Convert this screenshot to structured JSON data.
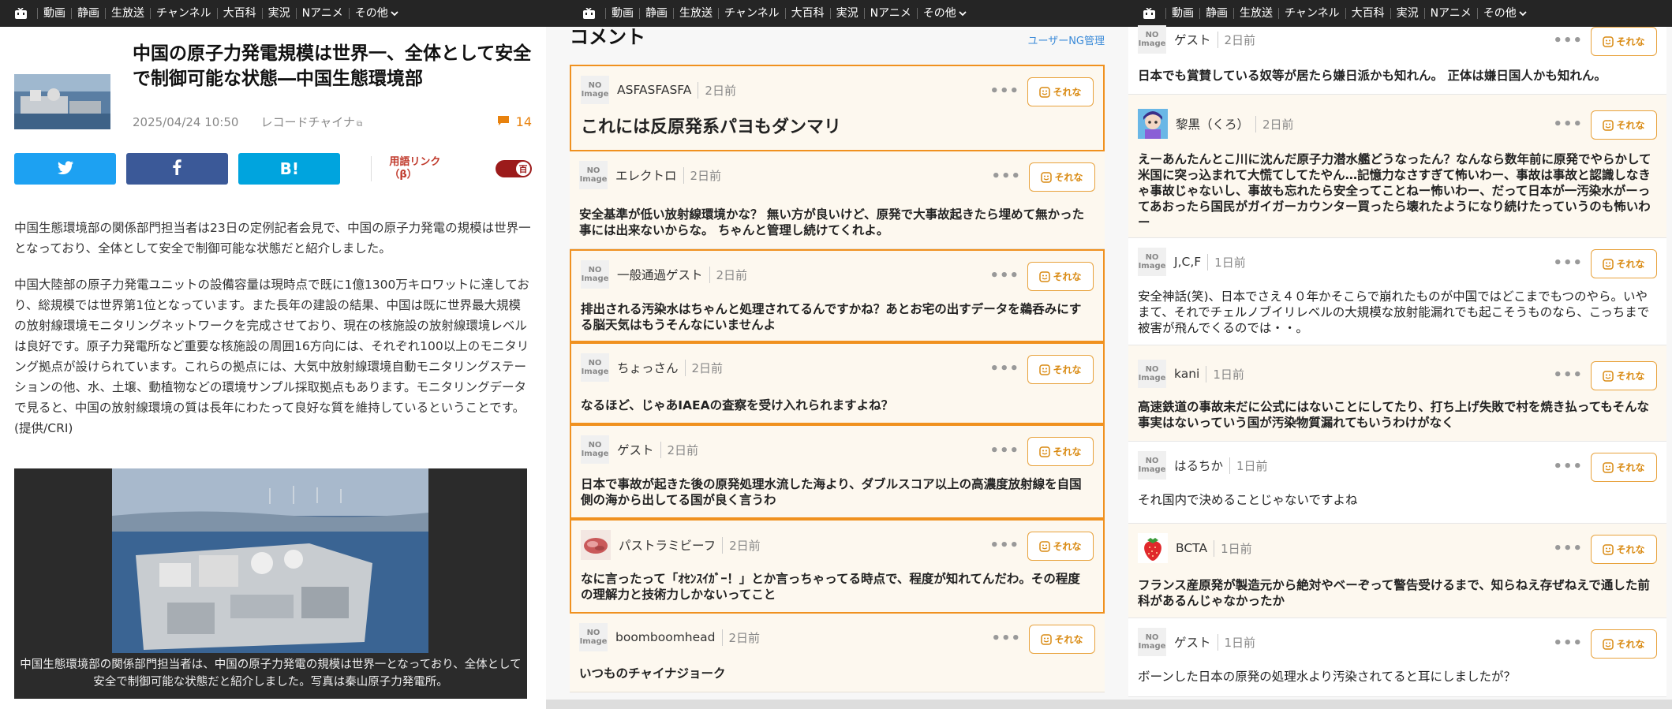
{
  "nav": {
    "items": [
      "動画",
      "静画",
      "生放送",
      "チャンネル",
      "大百科",
      "実況",
      "Nアニメ",
      "その他"
    ]
  },
  "article": {
    "title": "中国の原子力発電規模は世界一、全体として安全で制御可能な状態―中国生態環境部",
    "datetime": "2025/04/24 10:50",
    "source": "レコードチャイナ",
    "comment_count": "14",
    "share": {
      "hatena": "B!"
    },
    "yougo_link": "用語リンク（β）",
    "toggle_glyph": "百",
    "paragraphs": [
      "中国生態環境部の関係部門担当者は23日の定例記者会見で、中国の原子力発電の規模は世界一となっており、全体として安全で制御可能な状態だと紹介しました。",
      "中国大陸部の原子力発電ユニットの設備容量は現時点で既に1億1300万キロワットに達しており、総規模では世界第1位となっています。また長年の建設の結果、中国は既に世界最大規模の放射線環境モニタリングネットワークを完成させており、現在の核施設の放射線環境レベルは良好です。原子力発電所など重要な核施設の周囲16方向には、それぞれ100以上のモニタリング拠点が設けられています。これらの拠点には、大気中放射線環境自動モニタリングステーションの他、水、土壌、動植物などの環境サンプル採取拠点もあります。モニタリングデータで見ると、中国の放射線環境の質は長年にわたって良好な質を維持しているということです。(提供/CRI)"
    ],
    "photo_caption": "中国生態環境部の関係部門担当者は、中国の原子力発電の規模は世界一となっており、全体として安全で制御可能な状態だと紹介しました。写真は秦山原子力発電所。"
  },
  "comments_header": {
    "title": "コメント",
    "ng_link": "ユーザーNG管理"
  },
  "reaction_label": "それな",
  "noimage_label": "NO Image",
  "comments_mid": [
    {
      "name": "ASFASFASFA",
      "time": "2日前",
      "text": "これには反原発系パヨもダンマリ",
      "avatar": "noimage"
    },
    {
      "name": "エレクトロ",
      "time": "2日前",
      "text": "安全基準が低い放射線環境かな？ 無い方が良いけど、原発で大事故起きたら埋めて無かった事には出来ないからな。 ちゃんと管理し続けてくれよ。",
      "avatar": "noimage"
    },
    {
      "name": "一般通過ゲスト",
      "time": "2日前",
      "text": "排出される汚染水はちゃんと処理されてるんですかね？あとお宅の出すデータを鵜呑みにする脳天気はもうそんなにいませんよ",
      "avatar": "noimage"
    },
    {
      "name": "ちょっさん",
      "time": "2日前",
      "text": "なるほど、じゃあIAEAの査察を受け入れられますよね？",
      "avatar": "noimage"
    },
    {
      "name": "ゲスト",
      "time": "2日前",
      "text": "日本で事故が起きた後の原発処理水流した海より、ダブルスコア以上の高濃度放射線を自国側の海から出してる国が良く言うわ",
      "avatar": "noimage"
    },
    {
      "name": "パストラミビーフ",
      "time": "2日前",
      "text": "なに言ったって「ｵｾﾝｽｲｶﾞｰ！」とか言っちゃってる時点で、程度が知れてんだわ。その程度の理解力と技術力しかないってこと",
      "avatar": "meat"
    },
    {
      "name": "boomboomhead",
      "time": "2日前",
      "text": "いつものチャイナジョーク",
      "avatar": "noimage"
    }
  ],
  "comments_right": [
    {
      "name": "ゲスト",
      "time": "2日前",
      "text": "日本でも賞賛している奴等が居たら嫌日派かも知れん。 正体は嫌日国人かも知れん。",
      "avatar": "noimage"
    },
    {
      "name": "黎黒（くろ）",
      "time": "2日前",
      "text": "えーあんたんとこ川に沈んだ原子力潜水艦どうなったん？なんなら数年前に原発でやらかして米国に突っ込まれて大慌てしてたやん…記憶力なさすぎて怖いわー、事故は事故と認識しなきゃ事故じゃないし、事故も忘れたら安全ってことねー怖いわー、だって日本が一汚染水がーってあおったら国民がガイガーカウンター買ったら壊れたようになり続けたっていうのも怖いわー",
      "avatar": "anime"
    },
    {
      "name": "J,C,F",
      "time": "1日前",
      "text": "安全神話(笑)、日本でさえ４０年かそこらで崩れたものが中国ではどこまでもつのやら。いやまて、それでチェルノブイリレベルの大規模な放射能漏れでも起こそうものなら、こっちまで被害が飛んでくるのでは・・。",
      "avatar": "noimage"
    },
    {
      "name": "kani",
      "time": "1日前",
      "text": "高速鉄道の事故未だに公式にはないことにしてたり、打ち上げ失敗で村を焼き払ってもそんな事実はないっていう国が汚染物質漏れてもいうわけがなく",
      "avatar": "noimage"
    },
    {
      "name": "はるちか",
      "time": "1日前",
      "text": "それ国内で決めることじゃないですよね",
      "avatar": "noimage"
    },
    {
      "name": "BCTA",
      "time": "1日前",
      "text": "フランス産原発が製造元から絶対やベーぞって警告受けるまで、知らねえ存ぜねえで通した前科があるんじゃなかったか",
      "avatar": "strawberry"
    },
    {
      "name": "ゲスト",
      "time": "1日前",
      "text": "ボーンした日本の原発の処理水より汚染されてると耳にしましたが？",
      "avatar": "noimage"
    }
  ]
}
